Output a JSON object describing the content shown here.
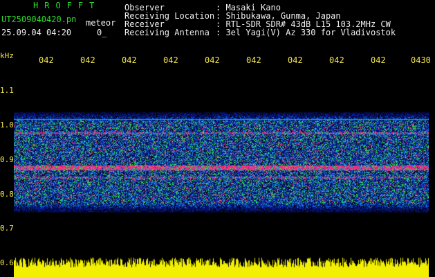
{
  "header": {
    "app_title": "HROFFT",
    "file_name": "UT2509040420.pn",
    "mode": "meteor",
    "date_time": "25.09.04 04:20",
    "counter": "0_"
  },
  "station": [
    {
      "label": "Observer",
      "value": ": Masaki Kano"
    },
    {
      "label": "Receiving Location",
      "value": ": Shibukawa, Gunma, Japan"
    },
    {
      "label": "Receiver",
      "value": ": RTL-SDR SDR# 43dB L15 103.2MHz CW"
    },
    {
      "label": "Receiving Antenna",
      "value": ": 3el Yagi(V) Az 330 for Vladivostok"
    }
  ],
  "axis": {
    "y_unit": "kHz",
    "y_ticks": [
      "1.1",
      "1.0",
      "0.9",
      "0.8",
      "0.7",
      "0.6"
    ],
    "x_ticks": [
      "042",
      "042",
      "042",
      "042",
      "042",
      "042",
      "042",
      "042",
      "042",
      "0430"
    ]
  },
  "colors": {
    "text_green": "#2bdc2b",
    "text_white": "#f0f0f0",
    "axis_yellow": "#f2e64a",
    "background": "#000000"
  }
}
